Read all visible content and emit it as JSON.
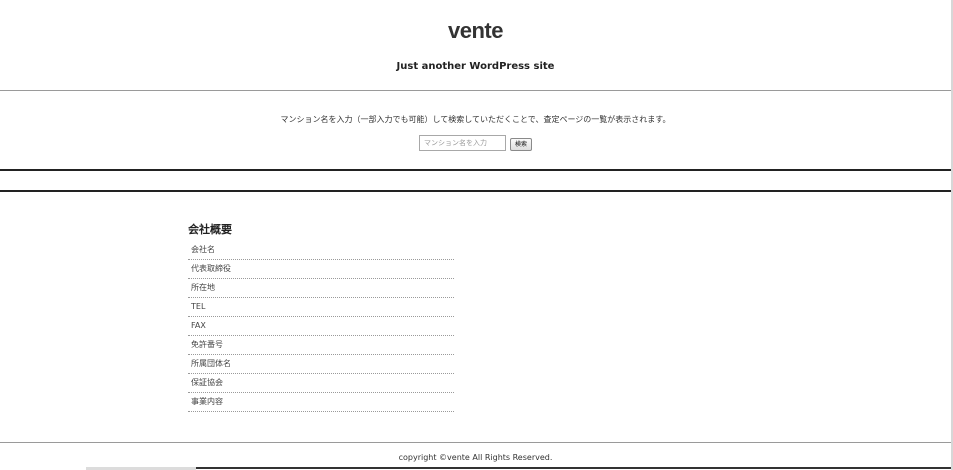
{
  "header": {
    "site_title": "vente",
    "site_description": "Just another WordPress site"
  },
  "search": {
    "instruction": "マンション名を入力（一部入力でも可能）して検索していただくことで、査定ページの一覧が表示されます。",
    "placeholder": "マンション名を入力",
    "button_label": "検索"
  },
  "company": {
    "heading": "会社概要",
    "items": [
      "会社名",
      "代表取締役",
      "所在地",
      "TEL",
      "FAX",
      "免許番号",
      "所属団体名",
      "保証協会",
      "事業内容"
    ]
  },
  "footer": {
    "copyright": "copyright ©vente All Rights Reserved."
  }
}
